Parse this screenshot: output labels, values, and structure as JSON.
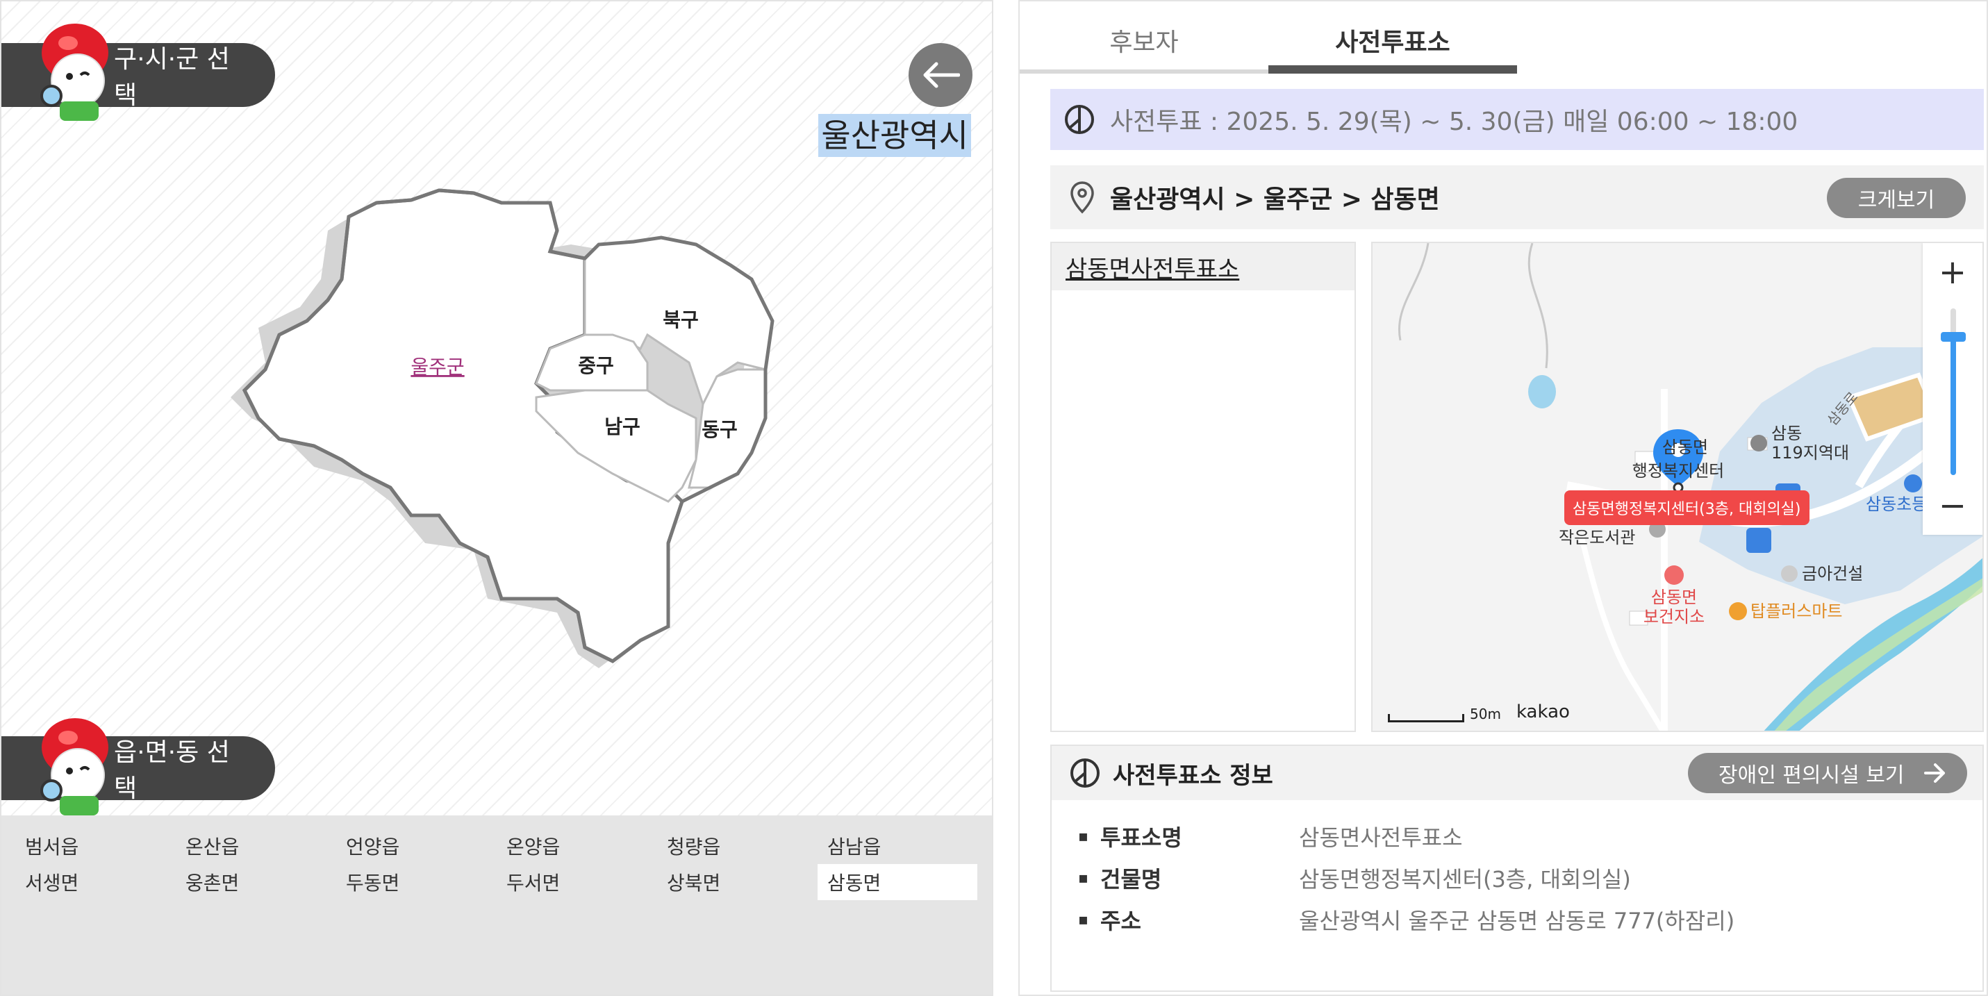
{
  "left": {
    "district_select_label": "구·시·군 선택",
    "town_select_label": "읍·면·동 선택",
    "city_title": "울산광역시",
    "map_regions": {
      "ulju": "울주군",
      "buk": "북구",
      "jung": "중구",
      "nam": "남구",
      "dong": "동구"
    },
    "towns": [
      "범서읍",
      "온산읍",
      "언양읍",
      "온양읍",
      "청량읍",
      "삼남읍",
      "서생면",
      "웅촌면",
      "두동면",
      "두서면",
      "상북면",
      "삼동면"
    ],
    "selected_town": "삼동면"
  },
  "right": {
    "tabs": [
      {
        "label": "후보자",
        "active": false
      },
      {
        "label": "사전투표소",
        "active": true
      }
    ],
    "period_text": "사전투표 : 2025. 5. 29(목) ~ 5. 30(금) 매일 06:00 ~ 18:00",
    "location_path": "울산광역시 > 울주군 > 삼동면",
    "enlarge_button": "크게보기",
    "station_list": [
      "삼동면사전투표소"
    ],
    "map": {
      "marker_label": "삼동면행정복지센터(3층, 대회의실)",
      "poi": {
        "center_line1": "삼동면",
        "center_line2": "행정복지센터",
        "fire_line1": "삼동",
        "fire_line2": "119지역대",
        "library": "작은도서관",
        "health_line1": "삼동면",
        "health_line2": "보건지소",
        "construction": "금아건설",
        "mart": "탑플러스마트",
        "school": "삼동초등",
        "road": "삼동로"
      },
      "scale_unit": "50m",
      "brand": "kakao",
      "zoom_in": "+",
      "zoom_out": "−"
    },
    "info": {
      "title": "사전투표소 정보",
      "accessibility_button": "장애인 편의시설 보기",
      "rows": [
        {
          "key": "투표소명",
          "value": "삼동면사전투표소"
        },
        {
          "key": "건물명",
          "value": "삼동면행정복지센터(3층, 대회의실)"
        },
        {
          "key": "주소",
          "value": "울산광역시 울주군 삼동면 삼동로 777(하잠리)"
        }
      ]
    }
  }
}
